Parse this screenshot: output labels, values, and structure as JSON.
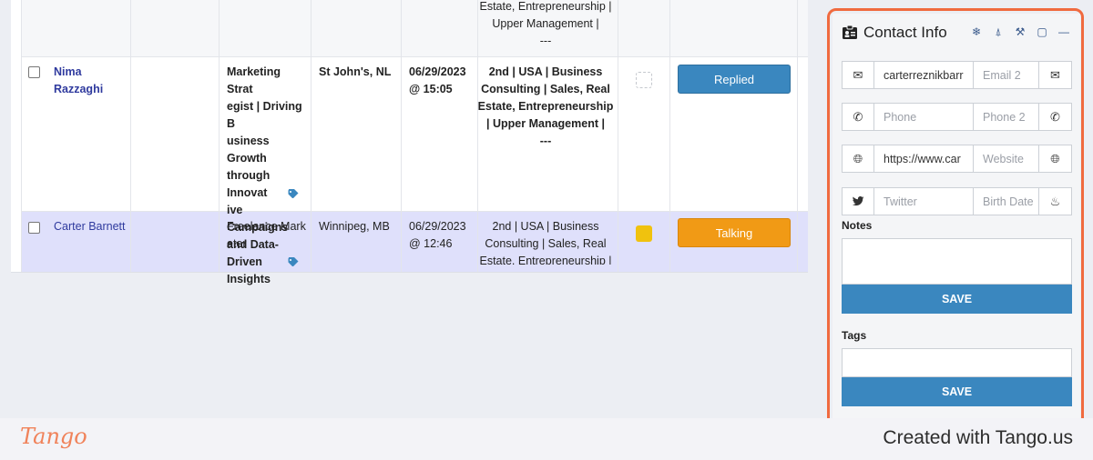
{
  "table": {
    "top_row": {
      "industry_lines": [
        "Estate, Entrepreneurship |",
        "Upper Management |",
        "---"
      ]
    },
    "rows": [
      {
        "name_lines": [
          "Nima",
          "Razzaghi"
        ],
        "headline_lines": [
          "Marketing Strat",
          "egist | Driving B",
          "usiness Growth",
          "through Innovat",
          "ive Campaigns",
          "and Data-Driven",
          "Insights"
        ],
        "location": "St John's, NL",
        "date_lines": [
          "06/29/2023",
          "@ 15:05"
        ],
        "industry_lines": [
          "2nd | USA | Business",
          "Consulting | Sales, Real",
          "Estate, Entrepreneurship",
          "| Upper Management |",
          "---"
        ],
        "status": "Replied"
      },
      {
        "name_lines": [
          "Carter Barnett"
        ],
        "headline_lines": [
          "Freelance Mark",
          "eter"
        ],
        "location": "Winnipeg, MB",
        "date_lines": [
          "06/29/2023",
          "@ 12:46"
        ],
        "industry_lines": [
          "2nd | USA | Business",
          "Consulting | Sales, Real",
          "Estate, Entrepreneurship |"
        ],
        "status": "Talking"
      }
    ]
  },
  "panel": {
    "title": "Contact Info",
    "email_value": "carterreznikbarr",
    "email2_placeholder": "Email 2",
    "phone_placeholder": "Phone",
    "phone2_placeholder": "Phone 2",
    "website_value": "https://www.car",
    "website2_placeholder": "Website",
    "twitter_placeholder": "Twitter",
    "birth_placeholder": "Birth Date",
    "notes_label": "Notes",
    "notes_save": "SAVE",
    "tags_label": "Tags",
    "tags_save": "SAVE"
  },
  "footer": {
    "logo": "Tango",
    "credit": "Created with Tango.us"
  },
  "colors": {
    "highlight_outline": "#f06a3f",
    "replied_button": "#3a87bf",
    "talking_button": "#f19a15",
    "selected_row": "#dfe0fb",
    "flag_yellow": "#f0c20e"
  },
  "icons": [
    "envelope-icon",
    "phone-icon",
    "globe-icon",
    "twitter-icon",
    "birthday-cake-icon",
    "id-card-icon",
    "snowflake-icon",
    "broom-icon",
    "magic-wand-icon",
    "clipboard-icon",
    "minimize-icon",
    "tag-icon"
  ]
}
